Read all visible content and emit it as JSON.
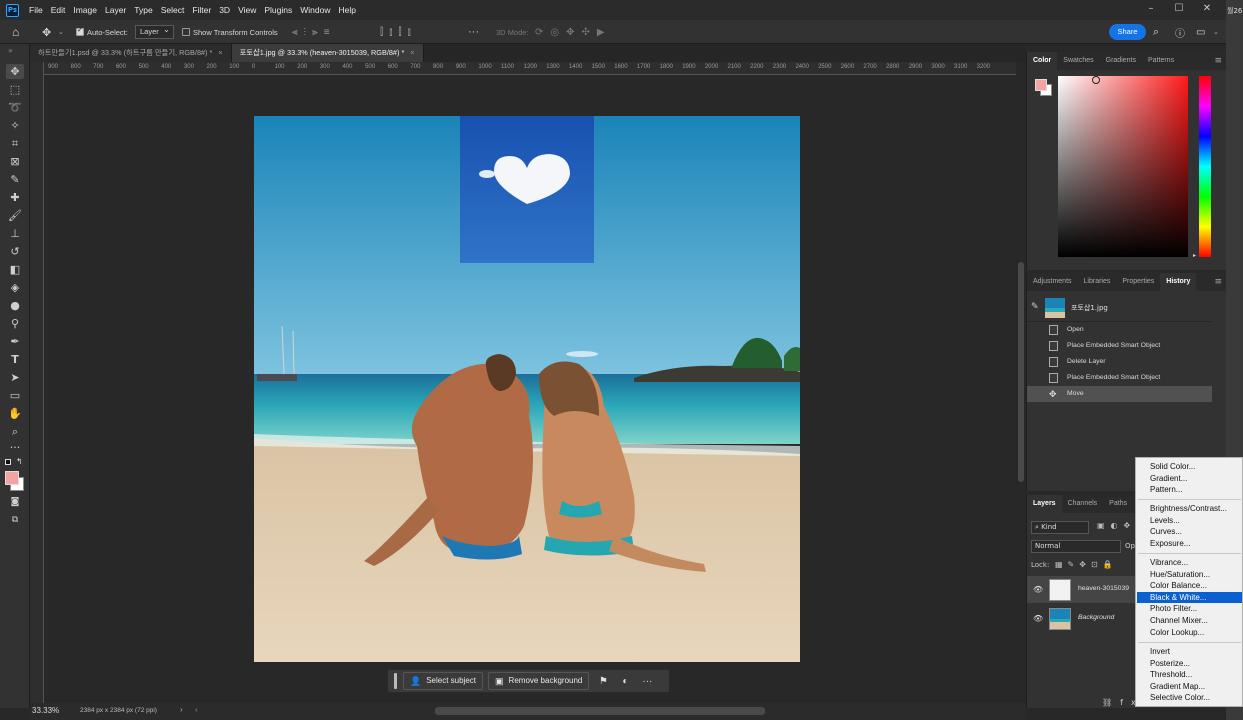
{
  "app": {
    "logo_text": "Ps",
    "menu": [
      "File",
      "Edit",
      "Image",
      "Layer",
      "Type",
      "Select",
      "Filter",
      "3D",
      "View",
      "Plugins",
      "Window",
      "Help"
    ],
    "share_label": "Share",
    "edge_text": "월26"
  },
  "options_bar": {
    "auto_select_label": "Auto-Select:",
    "auto_select_value": "Layer",
    "show_transform_label": "Show Transform Controls",
    "mode_3d_label": "3D Mode:"
  },
  "document_tabs": [
    {
      "label": "하트만들기1.psd @ 33.3% (하트구름 만들기, RGB/8#) *",
      "close": "×"
    },
    {
      "label": "포토샵1.jpg @ 33.3% (heaven-3015039, RGB/8#) *",
      "close": "×"
    }
  ],
  "ruler_top": [
    "900",
    "800",
    "700",
    "600",
    "500",
    "400",
    "300",
    "200",
    "100",
    "0",
    "100",
    "200",
    "300",
    "400",
    "500",
    "600",
    "700",
    "800",
    "900",
    "1000",
    "1100",
    "1200",
    "1300",
    "1400",
    "1500",
    "1600",
    "1700",
    "1800",
    "1900",
    "2000",
    "2100",
    "2200",
    "2300",
    "2400",
    "2500",
    "2600",
    "2700",
    "2800",
    "2900",
    "3000",
    "3100",
    "3200"
  ],
  "contextual_taskbar": {
    "select_subject": "Select subject",
    "remove_background": "Remove background",
    "more": "···"
  },
  "status": {
    "zoom": "33.33%",
    "doc_size": "2384 px x 2384 px (72 ppi)"
  },
  "color_panel": {
    "tabs": [
      "Color",
      "Swatches",
      "Gradients",
      "Patterns"
    ],
    "foreground": "#f4a3a3",
    "background": "#ffffff",
    "picker_hue": "#ff1a1a"
  },
  "history_panel": {
    "tabs": [
      "Adjustments",
      "Libraries",
      "Properties",
      "History"
    ],
    "snapshot_label": "포토샵1.jpg",
    "items": [
      "Open",
      "Place Embedded Smart Object",
      "Delete Layer",
      "Place Embedded Smart Object",
      "Move"
    ]
  },
  "layers_panel": {
    "tabs": [
      "Layers",
      "Channels",
      "Paths"
    ],
    "kind_label": "Kind",
    "blend_mode": "Normal",
    "opacity_short": "Op",
    "lock_label": "Lock:",
    "layers": [
      {
        "name": "heaven-3015039"
      },
      {
        "name": "Background"
      }
    ]
  },
  "adjustment_menu": {
    "group1": [
      "Solid Color...",
      "Gradient...",
      "Pattern..."
    ],
    "group2": [
      "Brightness/Contrast...",
      "Levels...",
      "Curves...",
      "Exposure..."
    ],
    "group3": [
      "Vibrance...",
      "Hue/Saturation...",
      "Color Balance...",
      "Black & White...",
      "Photo Filter...",
      "Channel Mixer...",
      "Color Lookup..."
    ],
    "group4": [
      "Invert",
      "Posterize...",
      "Threshold...",
      "Gradient Map...",
      "Selective Color..."
    ],
    "highlighted": "Black & White..."
  }
}
